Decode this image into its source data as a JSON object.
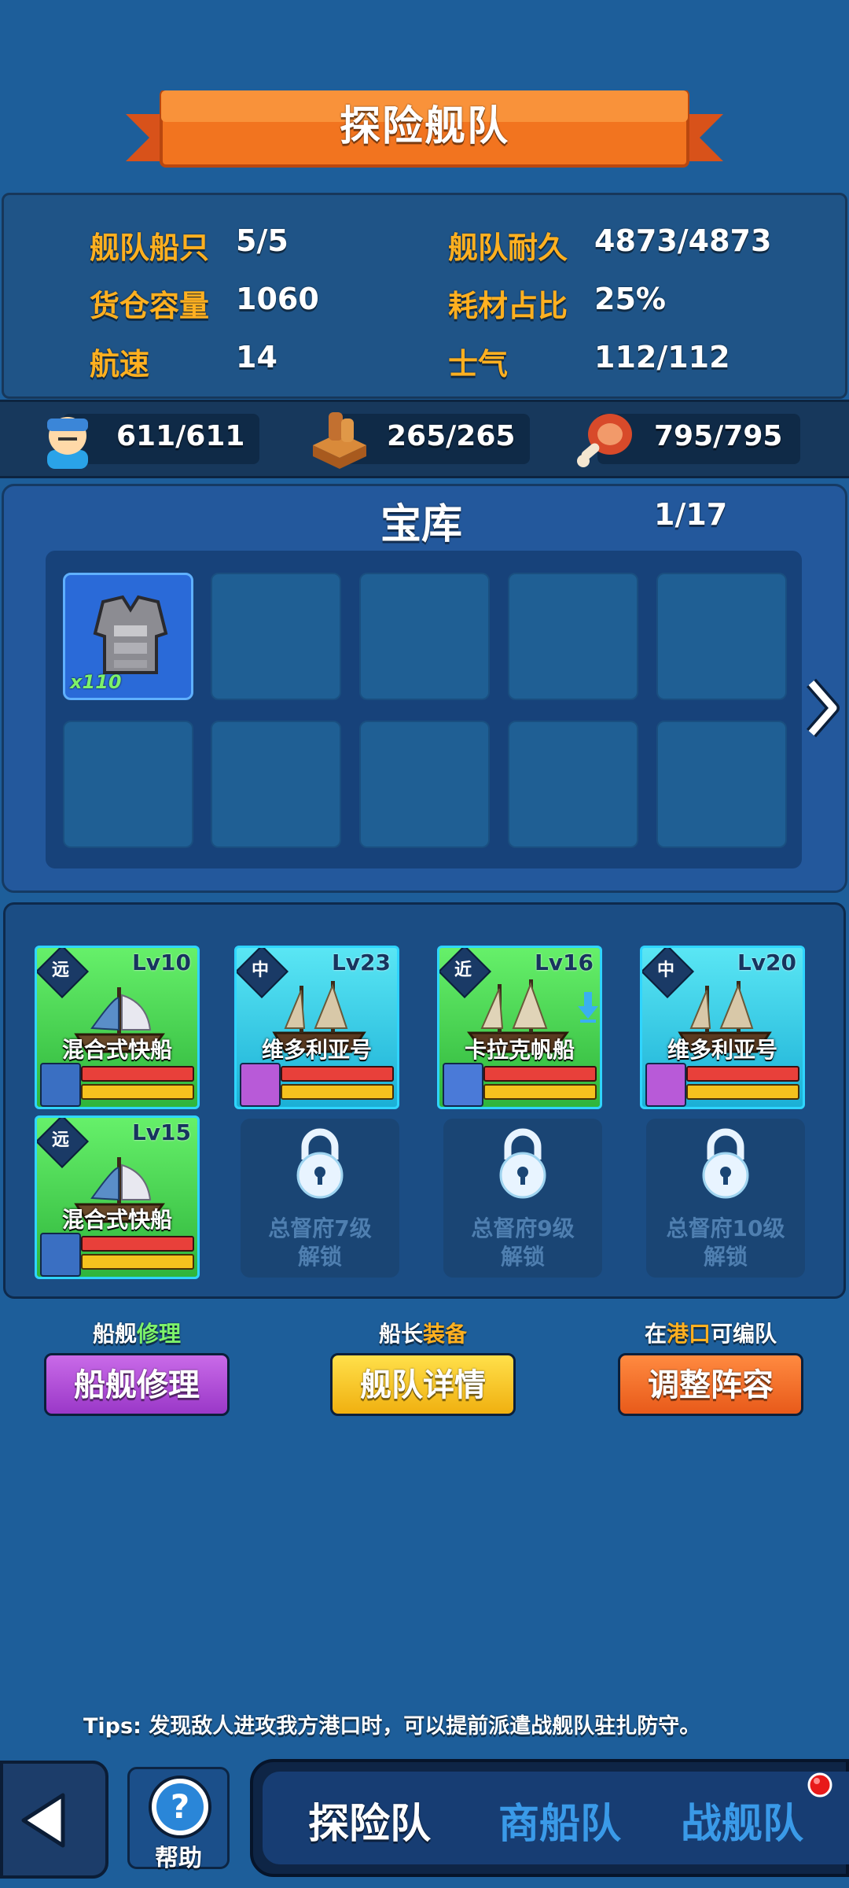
{
  "header": {
    "title": "探险舰队"
  },
  "stats": [
    {
      "label": "舰队船只",
      "value": "5/5"
    },
    {
      "label": "舰队耐久",
      "value": "4873/4873"
    },
    {
      "label": "货仓容量",
      "value": "1060"
    },
    {
      "label": "耗材占比",
      "value": "25%"
    },
    {
      "label": "航速",
      "value": "14"
    },
    {
      "label": "士气",
      "value": "112/112"
    }
  ],
  "resources": [
    {
      "icon": "crew-icon",
      "value": "611/611"
    },
    {
      "icon": "lumber-icon",
      "value": "265/265"
    },
    {
      "icon": "meat-icon",
      "value": "795/795"
    }
  ],
  "vault": {
    "title": "宝库",
    "count": "1/17",
    "items": [
      {
        "icon": "armor-icon",
        "quantity": "x110"
      }
    ]
  },
  "fleet": {
    "ships": [
      {
        "type": "远",
        "level": "Lv10",
        "name": "混合式快船",
        "color": "green"
      },
      {
        "type": "中",
        "level": "Lv23",
        "name": "维多利亚号",
        "color": "blue"
      },
      {
        "type": "近",
        "level": "Lv16",
        "name": "卡拉克帆船",
        "color": "green"
      },
      {
        "type": "中",
        "level": "Lv20",
        "name": "维多利亚号",
        "color": "blue"
      },
      {
        "type": "远",
        "level": "Lv15",
        "name": "混合式快船",
        "color": "green"
      }
    ],
    "locked": [
      {
        "line1": "总督府7级",
        "line2": "解锁"
      },
      {
        "line1": "总督府9级",
        "line2": "解锁"
      },
      {
        "line1": "总督府10级",
        "line2": "解锁"
      }
    ]
  },
  "actions": {
    "repair": {
      "caption_a": "船舰",
      "caption_b": "修理",
      "label": "船舰修理",
      "color": "#b84ad8"
    },
    "details": {
      "caption_a": "船长",
      "caption_b": "装备",
      "label": "舰队详情",
      "color": "#f3c21a"
    },
    "adjust": {
      "caption_a": "在",
      "caption_b": "港口",
      "caption_c": "可编队",
      "label": "调整阵容",
      "color": "#f0702a"
    }
  },
  "tips": {
    "prefix": "Tips:",
    "text": "发现敌人进攻我方港口时，可以提前派遣战舰队驻扎防守。"
  },
  "bottom": {
    "help_label": "帮助",
    "tabs": [
      "探险队",
      "商船队",
      "战舰队"
    ]
  }
}
